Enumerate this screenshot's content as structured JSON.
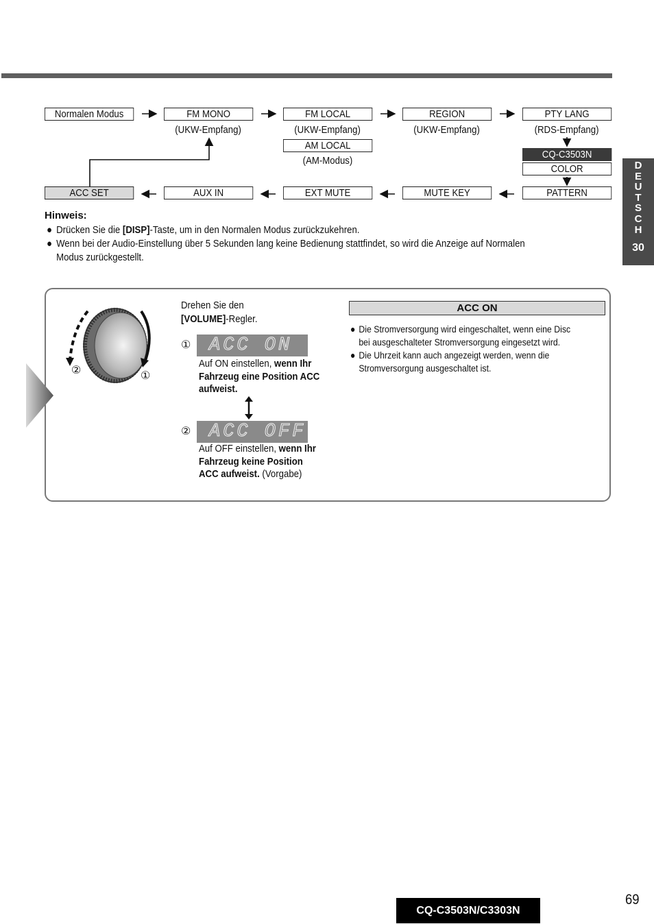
{
  "flow": {
    "row1": [
      {
        "label": "Normalen Modus",
        "sub": ""
      },
      {
        "label": "FM MONO",
        "sub": "(UKW-Empfang)"
      },
      {
        "label": "FM LOCAL",
        "sub": "(UKW-Empfang)"
      },
      {
        "label": "REGION",
        "sub": "(UKW-Empfang)"
      },
      {
        "label": "PTY LANG",
        "sub": "(RDS-Empfang)"
      }
    ],
    "am_local": {
      "label": "AM LOCAL",
      "sub": "(AM-Modus)"
    },
    "model_label": "CQ-C3503N",
    "color": "COLOR",
    "row2": [
      {
        "label": "ACC SET"
      },
      {
        "label": "AUX IN"
      },
      {
        "label": "EXT MUTE"
      },
      {
        "label": "MUTE KEY"
      },
      {
        "label": "PATTERN"
      }
    ],
    "arrow_right": "➞",
    "arrow_left": "⟵"
  },
  "side_tab": {
    "letters": [
      "D",
      "E",
      "U",
      "T",
      "S",
      "C",
      "H"
    ],
    "number": "30"
  },
  "hinweis": {
    "title": "Hinweis:",
    "items": [
      {
        "pre": "Drücken Sie die ",
        "bold": "[DISP]",
        "post": "-Taste, um in den Normalen Modus zurückzukehren."
      },
      {
        "line1": "Wenn bei der Audio-Einstellung über 5 Sekunden lang keine Bedienung stattfindet, so wird die Anzeige auf Normalen",
        "line2": "Modus zurückgestellt."
      }
    ],
    "bullet": "●"
  },
  "panel": {
    "instruction_line1": "Drehen Sie den",
    "instruction_bold": "[VOLUME]",
    "instruction_post": "-Regler.",
    "knob_labels": {
      "ccw": "②",
      "cw": "①"
    },
    "step1": {
      "num": "①",
      "display": "ACC ON",
      "text_normal": "Auf ON einstellen, ",
      "text_bold1": "wenn Ihr",
      "text_bold2": "Fahrzeug eine Position ACC",
      "text_bold3": "aufweist."
    },
    "step2": {
      "num": "②",
      "display": "ACC OFF",
      "text_normal": "Auf OFF einstellen, ",
      "text_bold1": "wenn Ihr",
      "text_bold2": "Fahrzeug keine Position",
      "text_bold3": "ACC aufweist.",
      "text_suffix": " (Vorgabe)"
    },
    "acc_on": {
      "header": "ACC ON",
      "items": [
        {
          "line1": "Die Stromversorgung wird eingeschaltet, wenn eine Disc",
          "line2": "bei ausgeschalteter Stromversorgung eingesetzt wird."
        },
        {
          "line1": "Die Uhrzeit kann auch angezeigt werden, wenn die",
          "line2": "Stromversorgung ausgeschaltet ist."
        }
      ]
    }
  },
  "footer": {
    "model": "CQ-C3503N/C3303N",
    "page": "69"
  }
}
